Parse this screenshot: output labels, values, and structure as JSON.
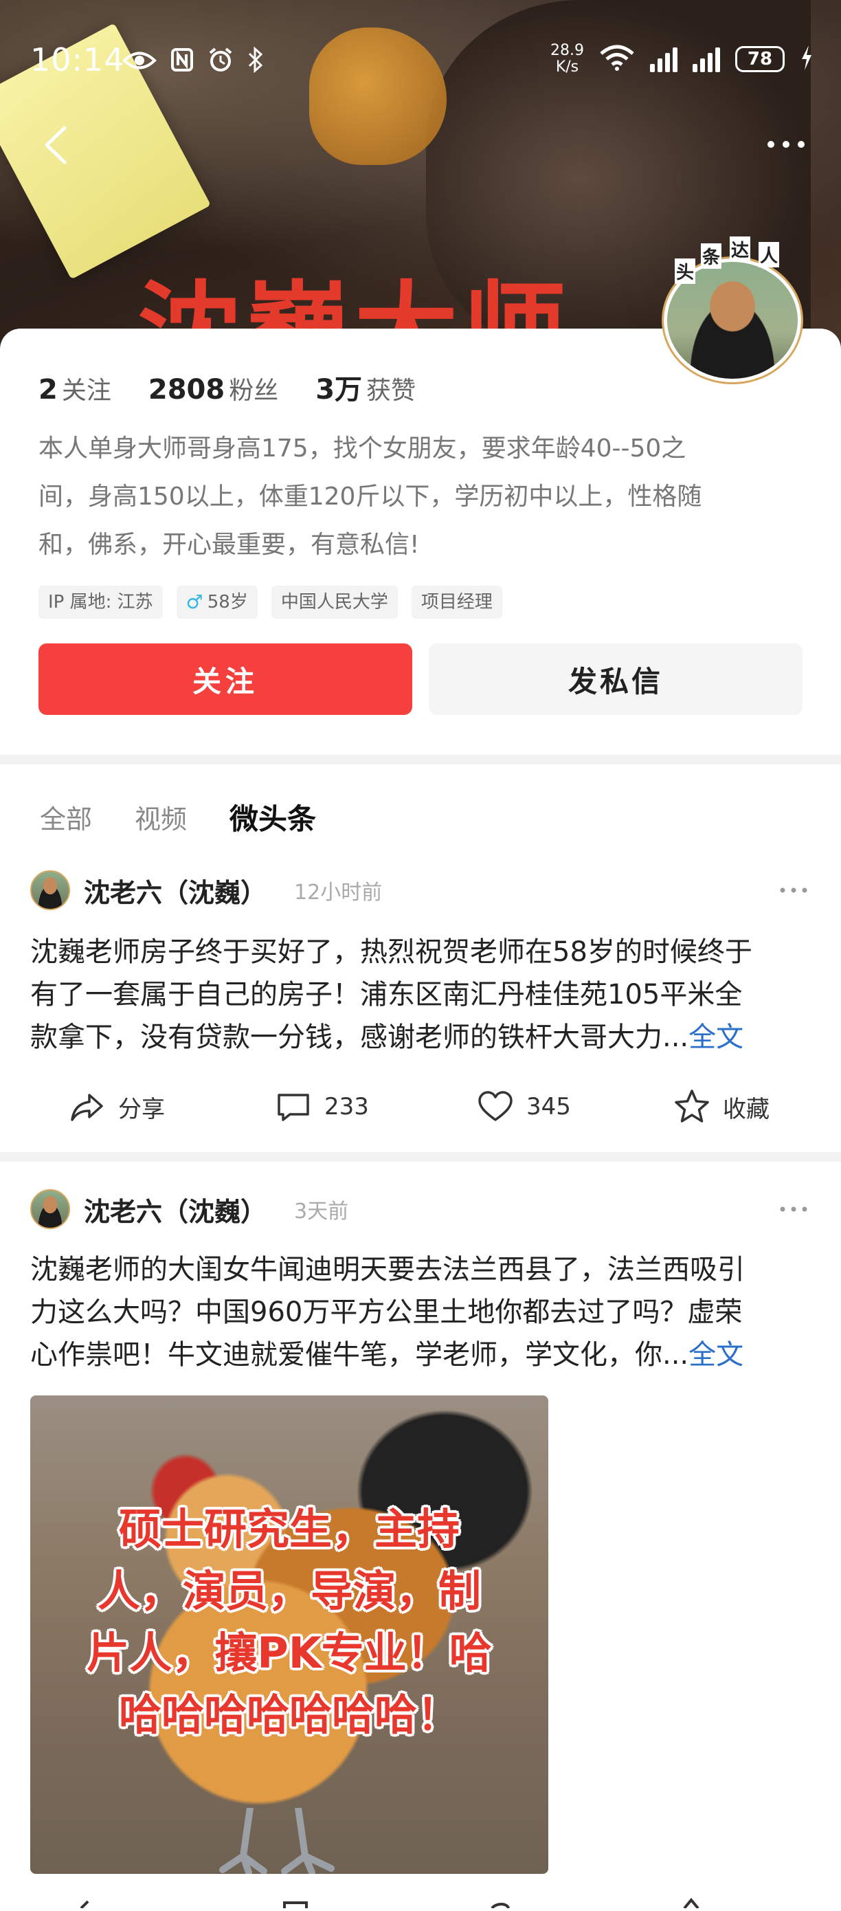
{
  "status_bar": {
    "time": "10:14",
    "net_speed_value": "28.9",
    "net_speed_unit": "K/s",
    "battery": "78"
  },
  "banner": {
    "title": "沈巍大师"
  },
  "avatar_badge": {
    "chars": [
      "头",
      "条",
      "达",
      "人"
    ]
  },
  "profile": {
    "stats": [
      {
        "num": "2",
        "label": "关注"
      },
      {
        "num": "2808",
        "label": "粉丝"
      },
      {
        "num": "3万",
        "label": "获赞"
      }
    ],
    "bio_lines": [
      "本人单身大师哥身高175，找个女朋友，要求年龄40--50之",
      "间，身高150以上，体重120斤以下，学历初中以上，性格随",
      "和，佛系，开心最重要，有意私信!"
    ],
    "tags": {
      "ip": "IP 属地: 江苏",
      "age": "58岁",
      "school": "中国人民大学",
      "job": "项目经理"
    },
    "follow_label": "关注",
    "message_label": "发私信"
  },
  "tabs": [
    {
      "label": "全部"
    },
    {
      "label": "视频"
    },
    {
      "label": "微头条"
    }
  ],
  "posts": [
    {
      "author": "沈老六（沈巍）",
      "time": "12小时前",
      "lines": [
        "沈巍老师房子终于买好了，热烈祝贺老师在58岁的时候终于",
        "有了一套属于自己的房子！浦东区南汇丹桂佳苑105平米全",
        "款拿下，没有贷款一分钱，感谢老师的铁杆大哥大力..."
      ],
      "more_label": "全文",
      "actions": {
        "share": "分享",
        "comments": "233",
        "likes": "345",
        "collect": "收藏"
      }
    },
    {
      "author": "沈老六（沈巍）",
      "time": "3天前",
      "lines": [
        "沈巍老师的大闺女牛闻迪明天要去法兰西县了，法兰西吸引",
        "力这么大吗？中国960万平方公里土地你都去过了吗？虚荣",
        "心作祟吧！牛文迪就爱催牛笔，学老师，学文化，你..."
      ],
      "more_label": "全文",
      "image_text_lines": [
        "硕士研究生，主持",
        "人，演员，导演，制",
        "片人，攘PK专业！哈",
        "哈哈哈哈哈哈哈！"
      ]
    }
  ],
  "colors": {
    "accent_red": "#f5403e",
    "link_blue": "#2a6fc9"
  }
}
